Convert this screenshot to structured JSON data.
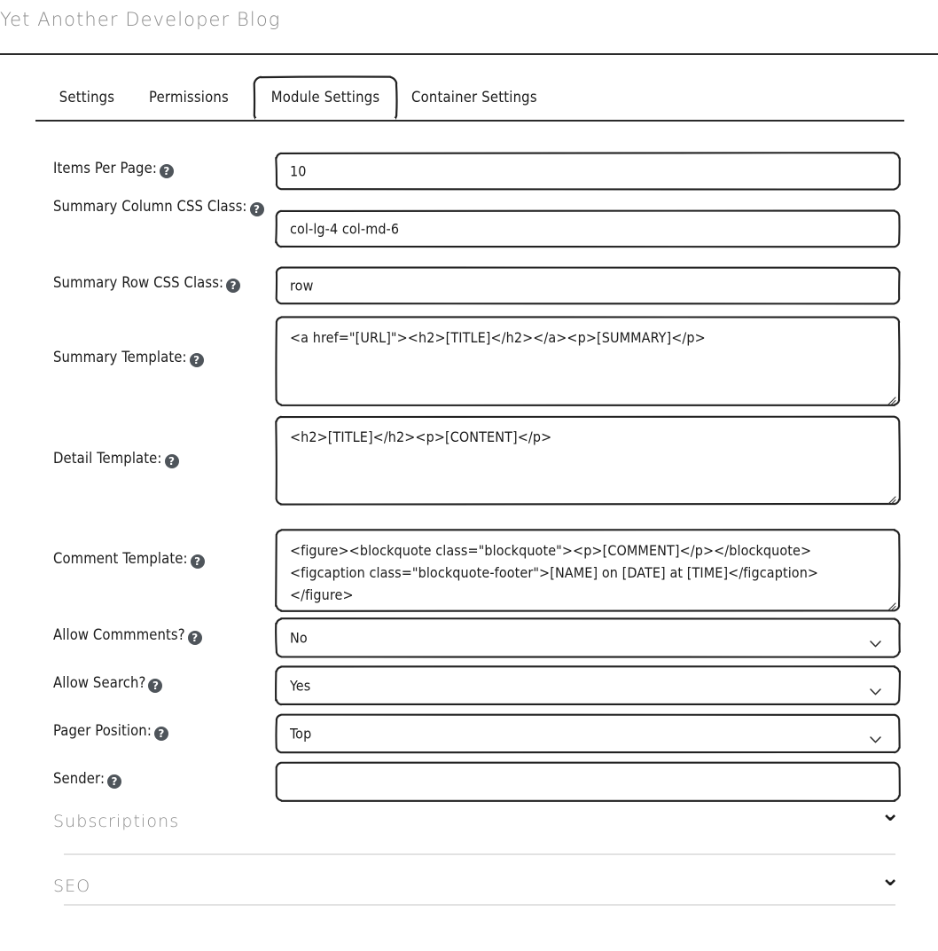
{
  "header": {
    "site_title": "Yet Another Developer Blog"
  },
  "tabs": [
    {
      "label": "Settings",
      "active": false
    },
    {
      "label": "Permissions",
      "active": false
    },
    {
      "label": "Module Settings",
      "active": true
    },
    {
      "label": "Container Settings",
      "active": false
    }
  ],
  "help_glyph": "?",
  "form": {
    "fields": [
      {
        "label": "Items Per Page:",
        "kind": "text",
        "value": "10",
        "help": true
      },
      {
        "label": "Summary Column CSS Class:",
        "kind": "text",
        "value": "col-lg-4 col-md-6",
        "help": true
      },
      {
        "label": "Summary Row CSS Class:",
        "kind": "text",
        "value": "row",
        "help": true
      },
      {
        "label": "Summary Template:",
        "kind": "textarea",
        "value": "<a href=\"[URL]\"><h2>[TITLE]</h2></a><p>[SUMMARY]</p>",
        "help": true
      },
      {
        "label": "Detail Template:",
        "kind": "textarea",
        "value": "<h2>[TITLE]</h2><p>[CONTENT]</p>",
        "help": true
      },
      {
        "label": "Comment Template:",
        "kind": "textarea",
        "value": "<figure><blockquote class=\"blockquote\"><p>[COMMENT]</p></blockquote><figcaption class=\"blockquote-footer\">[NAME] on [DATE] at [TIME]</figcaption></figure>",
        "help": true
      },
      {
        "label": "Allow Commments?",
        "kind": "select",
        "value": "No",
        "help": true
      },
      {
        "label": "Allow Search?",
        "kind": "select",
        "value": "Yes",
        "help": true
      },
      {
        "label": "Pager Position:",
        "kind": "select",
        "value": "Top",
        "help": true
      },
      {
        "label": "Sender:",
        "kind": "text",
        "value": "",
        "help": true
      }
    ]
  },
  "accordions": [
    {
      "title": "Subscriptions",
      "chevron": "⌄",
      "expanded": false
    },
    {
      "title": "SEO",
      "chevron": "⌄",
      "expanded": false
    }
  ],
  "colors": {
    "text": "#1c1c1c",
    "muted_title": "#8a8a8a",
    "help_badge": "#4f555b",
    "rule": "#2b2b2b",
    "divider": "#e2e2e2"
  }
}
